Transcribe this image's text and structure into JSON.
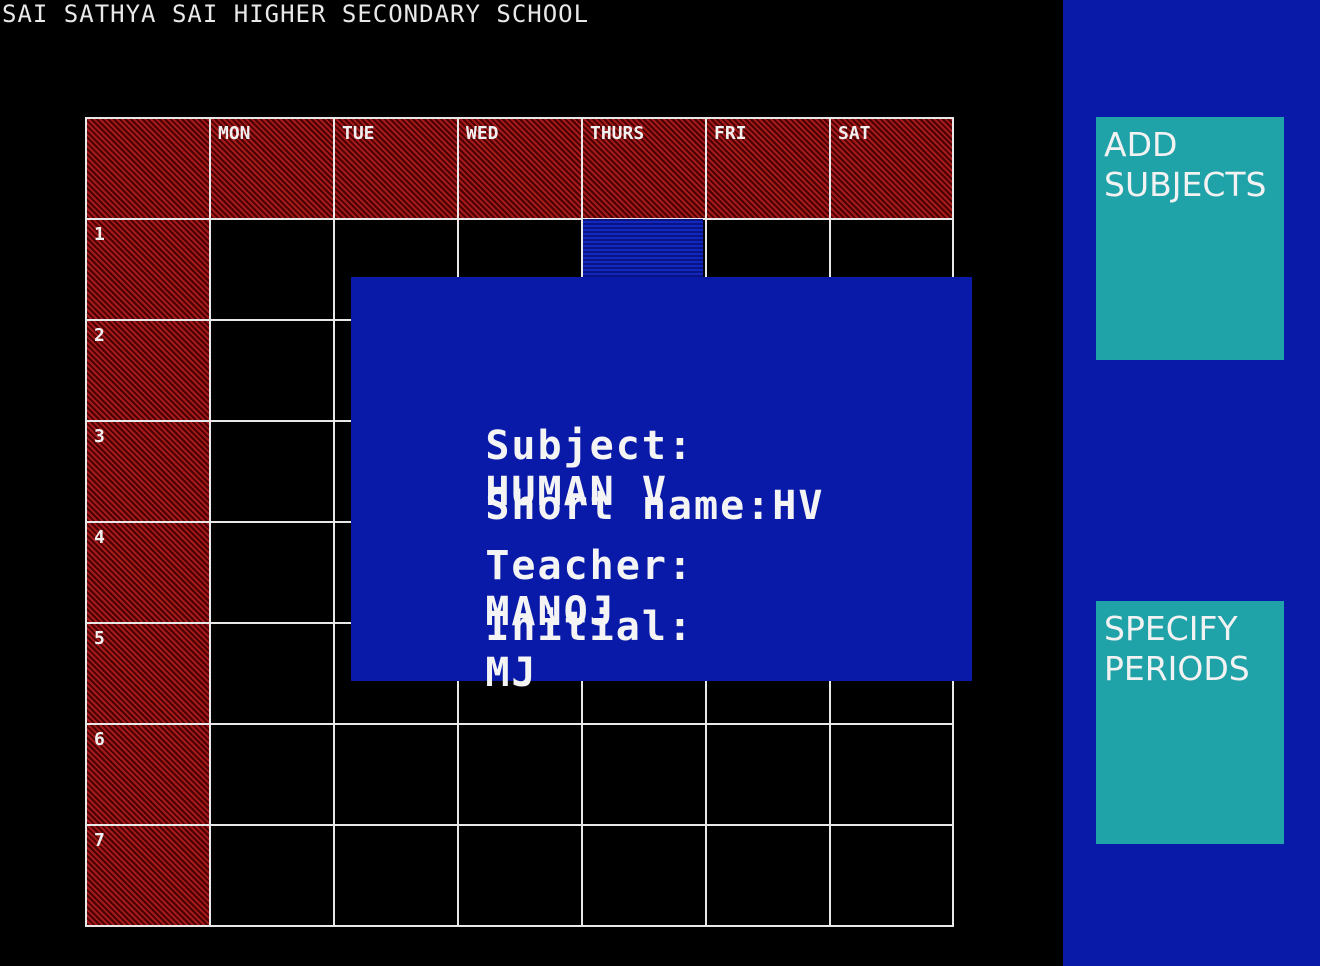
{
  "title": "SAI SATHYA SAI HIGHER SECONDARY SCHOOL",
  "timetable": {
    "days": [
      "MON",
      "TUE",
      "WED",
      "THURS",
      "FRI",
      "SAT"
    ],
    "periods": [
      "1",
      "2",
      "3",
      "4",
      "5",
      "6",
      "7"
    ]
  },
  "dialog": {
    "subject_label": "Subject:",
    "subject_value": "HUMAN V",
    "short_name_label": "Short name:",
    "short_name_value": "HV",
    "teacher_label": "Teacher:",
    "teacher_value": "MANOJ",
    "initial_label": "Initial:",
    "initial_value": "MJ"
  },
  "side_buttons": {
    "add_subjects": [
      "ADD",
      "SUBJECTS"
    ],
    "specify_periods": [
      "SPECIFY",
      "PERIODS"
    ]
  },
  "colors": {
    "background": "#000000",
    "panel_blue": "#0a1aa8",
    "button_teal": "#1fa2a8",
    "header_red": "#7a0c0c",
    "grid_line": "#e8e8e8"
  }
}
